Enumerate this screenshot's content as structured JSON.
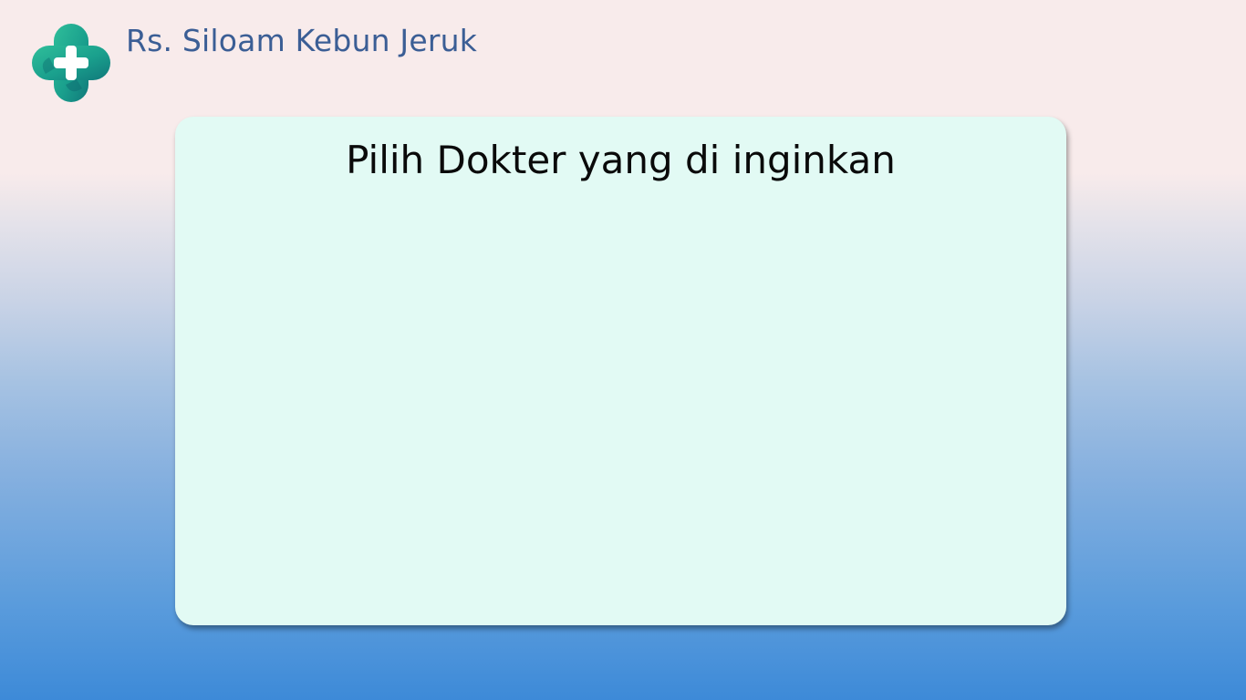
{
  "header": {
    "logo_icon": "medical-cross-icon",
    "title": "Rs. Siloam Kebun Jeruk",
    "title_color": "#3b5e95"
  },
  "main": {
    "panel_title": "Pilih Dokter yang di inginkan",
    "panel_color": "#e2faf4"
  }
}
